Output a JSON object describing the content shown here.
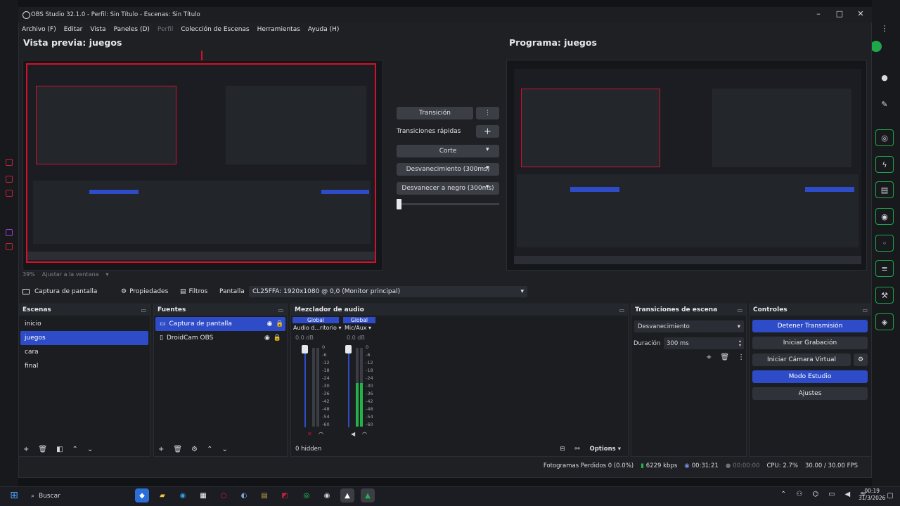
{
  "window": {
    "title": "OBS Studio 32.1.0 - Perfil: Sin Título - Escenas: Sin Título",
    "minimize_icon": "minimize-icon",
    "maximize_icon": "maximize-icon",
    "close_icon": "close-icon"
  },
  "menu": [
    "Archivo (F)",
    "Editar",
    "Vista",
    "Paneles (D)",
    "Perfil",
    "Colección de Escenas",
    "Herramientas",
    "Ayuda (H)"
  ],
  "preview": {
    "title": "Vista previa: juegos",
    "zoom": "39%",
    "fit_label": "Ajustar a la ventana"
  },
  "program": {
    "title": "Programa: juegos"
  },
  "transition_panel": {
    "transition_button": "Transición",
    "quick_label": "Transiciones rápidas",
    "quick_items": [
      "Corte",
      "Desvanecimiento (300ms)",
      "Desvanecer a negro (300ms)"
    ]
  },
  "source_toolbar": {
    "source_name": "Captura de pantalla",
    "properties": "Propiedades",
    "filters": "Filtros",
    "screen_label": "Pantalla",
    "screen_value": "CL25FFA: 1920x1080 @ 0,0 (Monitor principal)"
  },
  "scenes": {
    "title": "Escenas",
    "items": [
      "inicio",
      "juegos",
      "cara",
      "final"
    ],
    "selected_index": 1
  },
  "sources": {
    "title": "Fuentes",
    "items": [
      "Captura de pantalla",
      "DroidCam OBS"
    ]
  },
  "mixer": {
    "title": "Mezclador de audio",
    "channels": [
      {
        "global": "Global",
        "name": "Audio d...ritorio",
        "db": "0.0 dB",
        "level": 0.0
      },
      {
        "global": "Global",
        "name": "Mic/Aux",
        "db": "0.0 dB",
        "level": 0.55
      }
    ],
    "scale": [
      "0",
      "-6",
      "-12",
      "-18",
      "-24",
      "-30",
      "-36",
      "-42",
      "-48",
      "-54",
      "-60"
    ],
    "hidden_label": "0 hidden",
    "options_label": "Options"
  },
  "scene_transitions": {
    "title": "Transiciones de escena",
    "selected": "Desvanecimiento",
    "duration_label": "Duración",
    "duration_value": "300 ms"
  },
  "controls": {
    "title": "Controles",
    "stop_stream": "Detener Transmisión",
    "start_recording": "Iniciar Grabación",
    "start_virtual_cam": "Iniciar Cámara Virtual",
    "studio_mode": "Modo Estudio",
    "settings": "Ajustes"
  },
  "status": {
    "dropped_frames": "Fotogramas Perdidos 0 (0.0%)",
    "bitrate": "6229 kbps",
    "stream_time": "00:31:21",
    "rec_time": "00:00:00",
    "cpu": "CPU: 2.7%",
    "fps": "30.00 / 30.00 FPS"
  },
  "taskbar": {
    "search_placeholder": "Buscar",
    "time": "00:19",
    "date": "31/3/2026"
  },
  "colors": {
    "accent": "#2f4cc8",
    "preview_border": "#d4102a",
    "meter_green": "#23b34a",
    "meter_yellow": "#c7b62a"
  }
}
